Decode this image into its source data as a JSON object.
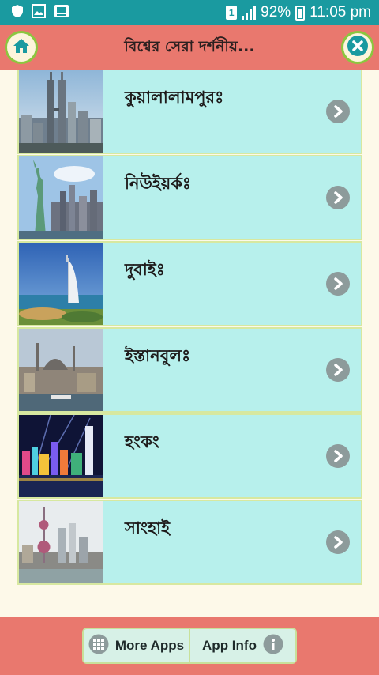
{
  "status_bar": {
    "sim_label": "1",
    "battery": "92%",
    "time": "11:05 pm"
  },
  "header": {
    "title": "বিশ্বের সেরা দর্শনীয়...",
    "home_icon": "home-icon",
    "close_icon": "close-icon"
  },
  "places": [
    {
      "label": "কুয়ালালামপুরঃ"
    },
    {
      "label": "নিউইয়র্কঃ"
    },
    {
      "label": "দুবাইঃ"
    },
    {
      "label": "ইস্তানবুলঃ"
    },
    {
      "label": "হংকং"
    },
    {
      "label": "সাংহাই"
    }
  ],
  "footer": {
    "more_apps_label": "More Apps",
    "app_info_label": "App Info"
  },
  "colors": {
    "status_bar": "#1a9aa0",
    "header": "#e9786e",
    "row_background": "#b7f0ec",
    "page_background": "#fdf9e9"
  }
}
